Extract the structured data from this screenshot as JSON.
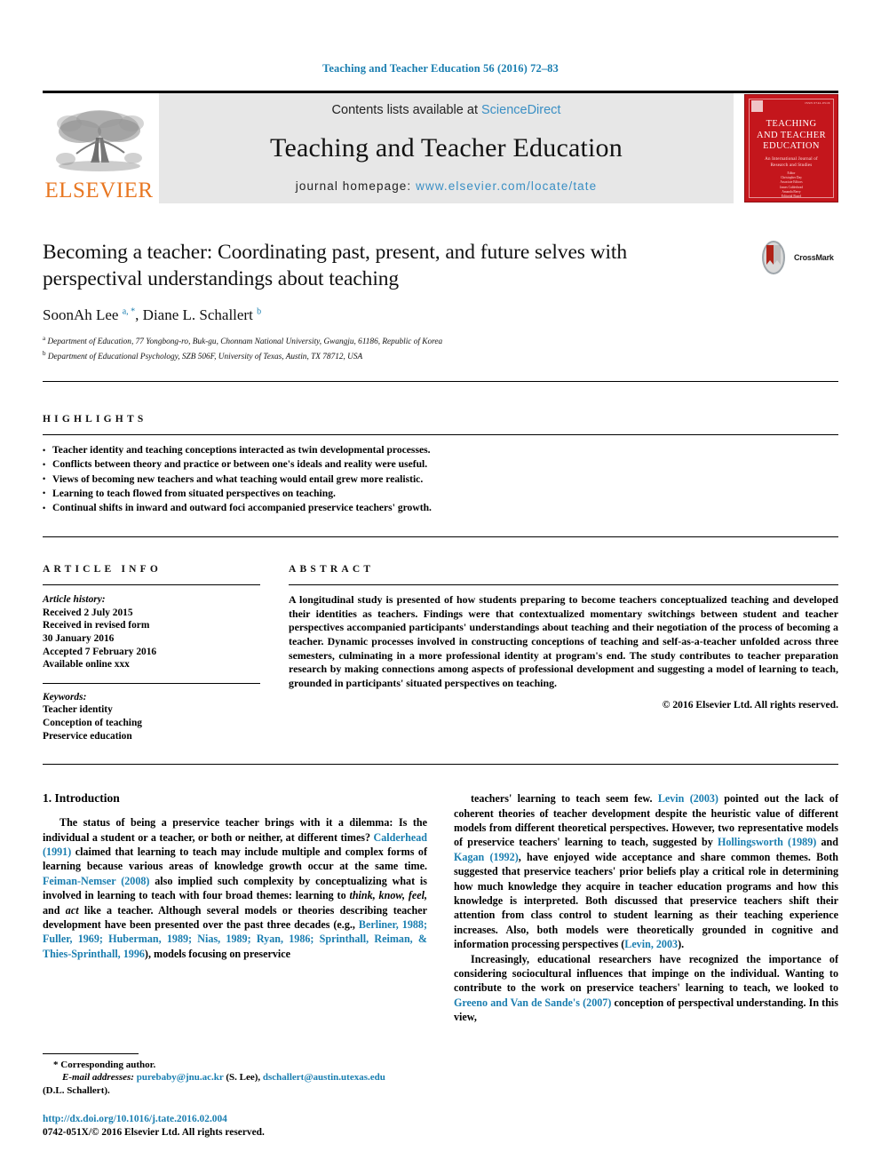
{
  "running_head": "Teaching and Teacher Education 56 (2016) 72–83",
  "masthead": {
    "publisher_name": "ELSEVIER",
    "contents_prefix": "Contents lists available at ",
    "contents_link": "ScienceDirect",
    "journal_title": "Teaching and Teacher Education",
    "homepage_prefix": "journal homepage: ",
    "homepage_url": "www.elsevier.com/locate/tate",
    "cover": {
      "title_line1": "TEACHING",
      "title_line2": "AND TEACHER",
      "title_line3": "EDUCATION",
      "subtitle_line1": "An International Journal of",
      "subtitle_line2": "Research and Studies",
      "editor_block": "Editor\nChristopher Day\nAssociate Editors\nJames Calderhead\nAmanda Berry\nEditorial Board",
      "issn": "ISSN 0742-051X"
    }
  },
  "article": {
    "title": "Becoming a teacher: Coordinating past, present, and future selves with perspectival understandings about teaching",
    "crossmark_label": "CrossMark",
    "authors_html": "SoonAh Lee <sup>a, *</sup>, Diane L. Schallert <sup>b</sup>",
    "affiliation_a": "Department of Education, 77 Yongbong-ro, Buk-gu, Chonnam National University, Gwangju, 61186, Republic of Korea",
    "affiliation_b": "Department of Educational Psychology, SZB 506F, University of Texas, Austin, TX 78712, USA"
  },
  "highlights": {
    "label": "HIGHLIGHTS",
    "items": [
      "Teacher identity and teaching conceptions interacted as twin developmental processes.",
      "Conflicts between theory and practice or between one's ideals and reality were useful.",
      "Views of becoming new teachers and what teaching would entail grew more realistic.",
      "Learning to teach flowed from situated perspectives on teaching.",
      "Continual shifts in inward and outward foci accompanied preservice teachers' growth."
    ]
  },
  "article_info": {
    "label": "ARTICLE INFO",
    "history_header": "Article history:",
    "history_lines": [
      "Received 2 July 2015",
      "Received in revised form",
      "30 January 2016",
      "Accepted 7 February 2016",
      "Available online xxx"
    ],
    "keywords_header": "Keywords:",
    "keywords": [
      "Teacher identity",
      "Conception of teaching",
      "Preservice education"
    ]
  },
  "abstract": {
    "label": "ABSTRACT",
    "text": "A longitudinal study is presented of how students preparing to become teachers conceptualized teaching and developed their identities as teachers. Findings were that contextualized momentary switchings between student and teacher perspectives accompanied participants' understandings about teaching and their negotiation of the process of becoming a teacher. Dynamic processes involved in constructing conceptions of teaching and self-as-a-teacher unfolded across three semesters, culminating in a more professional identity at program's end. The study contributes to teacher preparation research by making connections among aspects of professional development and suggesting a model of learning to teach, grounded in participants' situated perspectives on teaching.",
    "copyright": "© 2016 Elsevier Ltd. All rights reserved."
  },
  "body": {
    "section_title": "1. Introduction",
    "left_paragraph_segments": [
      {
        "t": "The status of being a preservice teacher brings with it a dilemma: Is the individual a student or a teacher, or both or neither, at different times? ",
        "k": "plain"
      },
      {
        "t": "Calderhead (1991)",
        "k": "ref"
      },
      {
        "t": " claimed that learning to teach may include multiple and complex forms of learning because various areas of knowledge growth occur at the same time. ",
        "k": "plain"
      },
      {
        "t": "Feiman-Nemser (2008)",
        "k": "ref"
      },
      {
        "t": " also implied such complexity by conceptualizing what is involved in learning to teach with four broad themes: learning to ",
        "k": "plain"
      },
      {
        "t": "think, know, feel,",
        "k": "ital"
      },
      {
        "t": " and ",
        "k": "plain"
      },
      {
        "t": "act",
        "k": "ital"
      },
      {
        "t": " like a teacher. Although several models or theories describing teacher development have been presented over the past three decades (e.g., ",
        "k": "plain"
      },
      {
        "t": "Berliner, 1988; Fuller, 1969; Huberman, 1989; Nias, 1989; Ryan, 1986; Sprinthall, Reiman, & Thies-Sprinthall, 1996",
        "k": "ref"
      },
      {
        "t": "), models focusing on preservice",
        "k": "plain"
      }
    ],
    "right_paragraph1_segments": [
      {
        "t": "teachers' learning to teach seem few. ",
        "k": "plain"
      },
      {
        "t": "Levin (2003)",
        "k": "ref"
      },
      {
        "t": " pointed out the lack of coherent theories of teacher development despite the heuristic value of different models from different theoretical perspectives. However, two representative models of preservice teachers' learning to teach, suggested by ",
        "k": "plain"
      },
      {
        "t": "Hollingsworth (1989)",
        "k": "ref"
      },
      {
        "t": " and ",
        "k": "plain"
      },
      {
        "t": "Kagan (1992)",
        "k": "ref"
      },
      {
        "t": ", have enjoyed wide acceptance and share common themes. Both suggested that preservice teachers' prior beliefs play a critical role in determining how much knowledge they acquire in teacher education programs and how this knowledge is interpreted. Both discussed that preservice teachers shift their attention from class control to student learning as their teaching experience increases. Also, both models were theoretically grounded in cognitive and information processing perspectives (",
        "k": "plain"
      },
      {
        "t": "Levin, 2003",
        "k": "ref"
      },
      {
        "t": ").",
        "k": "plain"
      }
    ],
    "right_paragraph2_segments": [
      {
        "t": "Increasingly, educational researchers have recognized the importance of considering sociocultural influences that impinge on the individual. Wanting to contribute to the work on preservice teachers' learning to teach, we looked to ",
        "k": "plain"
      },
      {
        "t": "Greeno and Van de Sande's (2007)",
        "k": "ref"
      },
      {
        "t": " conception of perspectival understanding. In this view,",
        "k": "plain"
      }
    ]
  },
  "footnote": {
    "corresponding": "* Corresponding author.",
    "email_label": "E-mail addresses:",
    "email1": "purebaby@jnu.ac.kr",
    "email1_owner": " (S. Lee), ",
    "email2": "dschallert@austin.utexas.edu",
    "email2_owner": "(D.L. Schallert).",
    "doi": "http://dx.doi.org/10.1016/j.tate.2016.02.004",
    "issn_line": "0742-051X/© 2016 Elsevier Ltd. All rights reserved."
  },
  "colors": {
    "link": "#1a7eb0",
    "sciencedirect": "#3a8fc4",
    "elsevier_orange": "#e87722",
    "cover_red": "#c4161c",
    "band_gray": "#e7e7e7"
  }
}
